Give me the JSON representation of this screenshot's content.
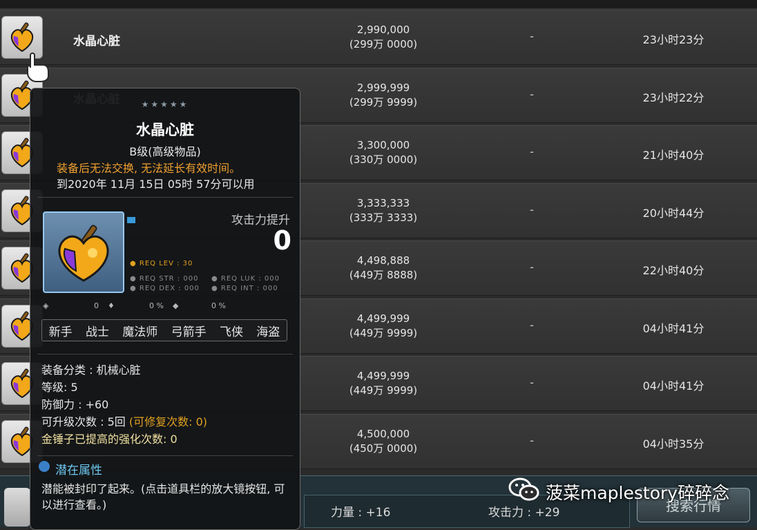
{
  "listings": [
    {
      "name": "水晶心脏",
      "price": "2,990,000",
      "price_wan": "(299万 0000)",
      "attack": "-",
      "time_left": "23小时23分"
    },
    {
      "name": "水晶心脏",
      "price": "2,999,999",
      "price_wan": "(299万 9999)",
      "attack": "-",
      "time_left": "23小时22分"
    },
    {
      "name": "",
      "price": "3,300,000",
      "price_wan": "(330万 0000)",
      "attack": "-",
      "time_left": "21小时40分"
    },
    {
      "name": "",
      "price": "3,333,333",
      "price_wan": "(333万 3333)",
      "attack": "-",
      "time_left": "20小时44分"
    },
    {
      "name": "",
      "price": "4,498,888",
      "price_wan": "(449万 8888)",
      "attack": "-",
      "time_left": "22小时40分"
    },
    {
      "name": "",
      "price": "4,499,999",
      "price_wan": "(449万 9999)",
      "attack": "-",
      "time_left": "04小时41分"
    },
    {
      "name": "",
      "price": "4,499,999",
      "price_wan": "(449万 9999)",
      "attack": "-",
      "time_left": "04小时41分"
    },
    {
      "name": "",
      "price": "4,500,000",
      "price_wan": "(450万 0000)",
      "attack": "-",
      "time_left": "04小时35分"
    }
  ],
  "tooltip": {
    "stars": "★★★★★",
    "title": "水晶心脏",
    "grade": "B级(高级物品)",
    "warning": "装备后无法交换, 无法延长有效时间。",
    "expiry": "到2020年 11月 15日 05时 57分可以用",
    "attack_label": "攻击力提升",
    "attack_value": "0",
    "req_lev": "● REQ LEV : 30",
    "req_str": "● REQ STR : 000",
    "req_dex": "● REQ DEX : 000",
    "req_luk": "● REQ LUK : 000",
    "req_int": "● REQ INT : 000",
    "stat_a": "0",
    "stat_b": "0 %",
    "stat_c": "0 %",
    "classes": [
      "新手",
      "战士",
      "魔法师",
      "弓箭手",
      "飞侠",
      "海盗"
    ],
    "category": "装备分类 : 机械心脏",
    "level": "等级: 5",
    "defense": "防御力 : +60",
    "upgrades": "可升级次数 : 5回",
    "repairs": "(可修复次数: 0)",
    "hammer": "金锤子已提高的强化次数: 0",
    "potential_title": "潜在属性",
    "potential_desc": "潜能被封印了起来。(点击道具栏的放大镜按钮, 可以进行查看。)"
  },
  "footer": {
    "stat_strength": "力量 : +16",
    "stat_attack": "攻击力 : +29",
    "search_button": "搜索行情",
    "watermark": "菠菜maplestory碎碎念"
  },
  "colors": {
    "warning": "#f0a030",
    "potential": "#6ec8f0",
    "req_lev": "#e0a020"
  }
}
